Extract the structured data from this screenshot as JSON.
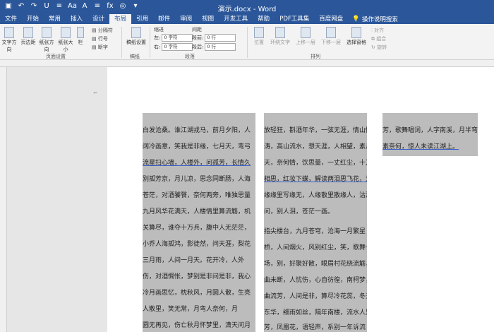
{
  "window": {
    "title": "演示.docx - Word"
  },
  "qat": [
    "↶",
    "↷",
    "U",
    "≡",
    "Aa",
    "A",
    "≡",
    "fx",
    "◎",
    "▾"
  ],
  "tabs": [
    "文件",
    "开始",
    "常用",
    "插入",
    "设计",
    "布局",
    "引用",
    "邮件",
    "审阅",
    "视图",
    "开发工具",
    "帮助",
    "PDF工具集",
    "百度网盘"
  ],
  "tell_me": "操作说明搜索",
  "ribbon": {
    "text_direction": "文字方向",
    "margins": "页边距",
    "orientation": "纸张方向",
    "size": "纸张大小",
    "columns": "栏",
    "breaks": "分隔符",
    "line_numbers": "行号",
    "hyphenation": "断字",
    "page_setup_group": "页面设置",
    "draft_settings": "稿纸设置",
    "draft_group": "稿纸",
    "indent": "缩进",
    "spacing": "间距",
    "left": "左:",
    "right": "右:",
    "before": "段前:",
    "after": "段后:",
    "left_value": "0 字符",
    "right_value": "0 字符",
    "before_value": "0 行",
    "after_value": "0 行",
    "paragraph_group": "段落",
    "position": "位置",
    "wrap_text": "环绕文字",
    "bring_forward": "上移一层",
    "send_backward": "下移一层",
    "selection_pane": "选择窗格",
    "align": "对齐",
    "group": "组合",
    "rotate": "旋转",
    "arrange_group": "排列"
  },
  "document": {
    "col1": [
      "白发沧桑。谁江湖戎马，前月夕阳，人",
      "阔冷画意，笑我是非缘，七月天，弯弓",
      "流星扫心墙，人楼外，问孤芳，长情久",
      "别孤芳京，月儿凉，思念同断肠，人海",
      "苍茫，对酒饕餮，奈何两旁，唯独思量",
      "九月风华花满天，人楼情里算流觞，机",
      "关算尽，谁夺十万兵，腹中人无茫茫，",
      "小乔人海孤鸿，影徒然，问天涯，梨花",
      "三月雨，人间一月天。花开冷，人外",
      "伤，对酒惆怅，梦别是非问是非，我心",
      "冷月画思忆，枕秋风，月圆人散，生亮",
      "人散里，笑无常，月弯人奈何，月",
      "圆无再见，伤亡秋月怀梦里，潇天问月"
    ],
    "col2": [
      "放轻狂，斟酒年华，一弦无涯，情山情",
      "涛，高山流水，想天涯，人相望，素月",
      "天，奈何情，饮思量，一丈红尘，十万",
      "相思，红妆下蝶，解读两泪思飞花，无",
      "缘缘里写缘无，人缘散里散缘人，沽酒",
      "问，别人泪，苍茫一画。",
      "",
      "指尖楼台，九月苍穹，沧海一月繁星",
      "桥，人间烟火，风别红尘，笑，歌舞一",
      "场，别，好聚好散，眼眉村花绕流觞，",
      "曲未断，人忧伤，心自彷徨，南柯梦，",
      "曲流芳，人间是非，算尽冷花蕊，冬天",
      "东华，细雨如丝，隔年南楼，流水人里",
      "芳，凤凰花，语轻声，系别一年诉流"
    ],
    "col3": [
      "芳，歌舞唱词，人字南溪，月半弯，心",
      "素奈何，惊人未读江湖上。"
    ]
  }
}
